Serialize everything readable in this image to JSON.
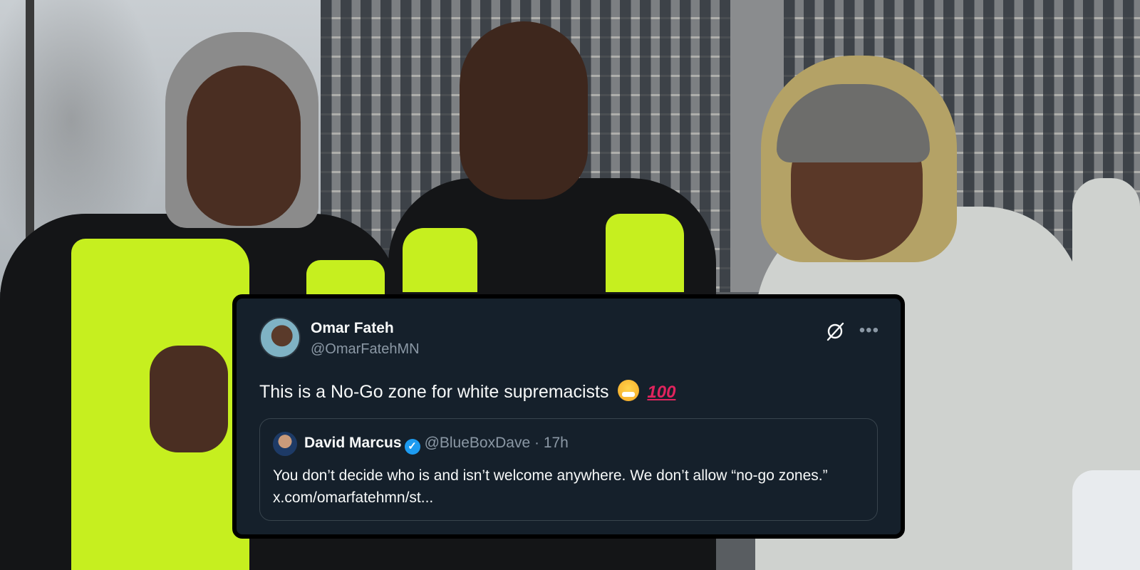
{
  "tweet": {
    "author_name": "Omar Fateh",
    "author_handle": "@OmarFatehMN",
    "text": "This is a No-Go zone for white supremacists",
    "emoji_names": [
      "face-with-steam-from-nose",
      "hundred-points"
    ],
    "menu_icon": "more-horizontal-icon",
    "grok_icon": "grok-icon"
  },
  "quoted_tweet": {
    "author_name": "David Marcus",
    "author_handle": "@BlueBoxDave",
    "separator": "·",
    "time": "17h",
    "verified": true,
    "text": "You don’t decide who is and isn’t welcome anywhere. We don’t allow “no-go zones.” x.com/omarfatehmn/st..."
  },
  "colors": {
    "card_background": "#15202b",
    "card_border": "#000000",
    "primary_text": "#f7f9f9",
    "secondary_text": "#8b98a5",
    "verified_blue": "#1d9bf0",
    "quote_border": "#38444d"
  }
}
